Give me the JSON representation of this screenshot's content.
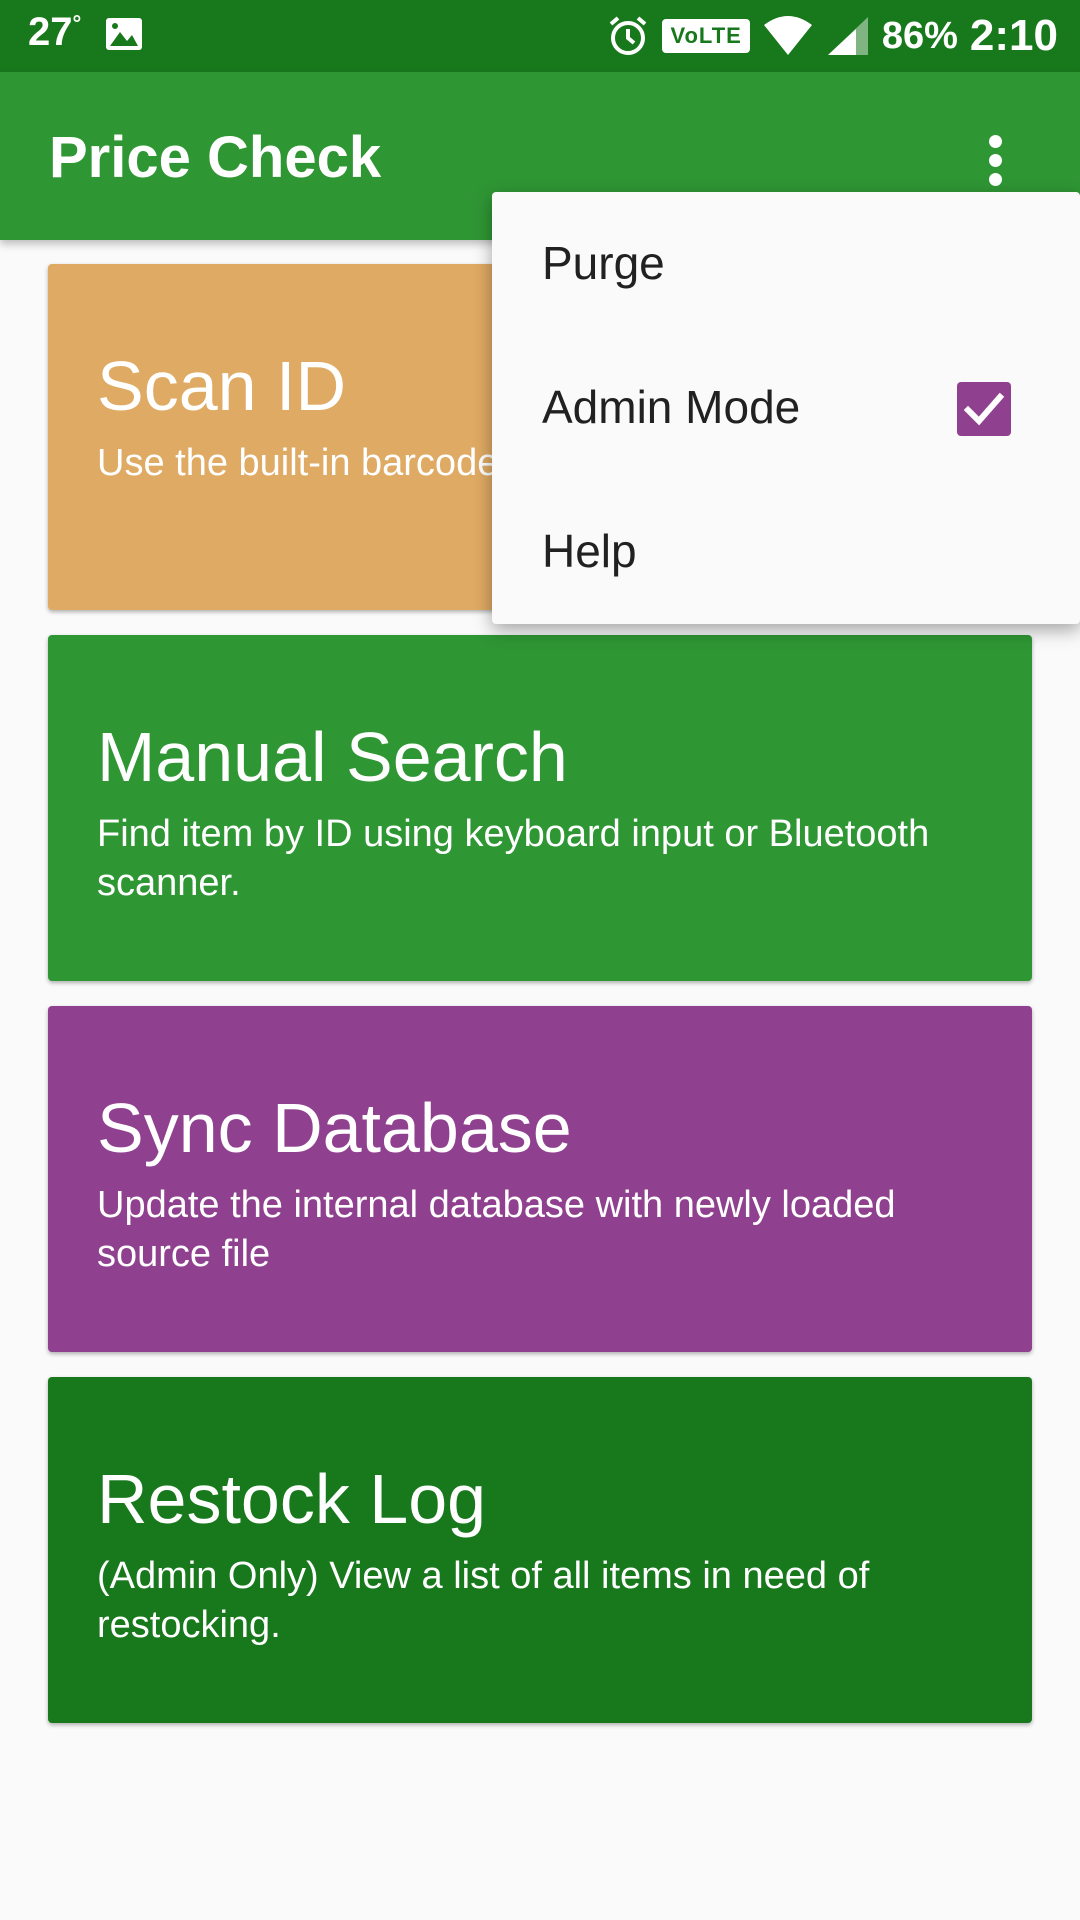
{
  "status_bar": {
    "temperature": "27",
    "degree_symbol": "°",
    "volte": "VoLTE",
    "battery": "86%",
    "time": "2:10"
  },
  "app_bar": {
    "title": "Price Check"
  },
  "menu": {
    "items": [
      {
        "label": "Purge"
      },
      {
        "label": "Admin Mode",
        "checked": true
      },
      {
        "label": "Help"
      }
    ]
  },
  "cards": [
    {
      "title": "Scan ID",
      "description": "Use the built-in barcode scanner to identify items",
      "color": "#dfaa63"
    },
    {
      "title": "Manual Search",
      "description": "Find item by ID using keyboard input or Bluetooth scanner.",
      "color": "#2f9634"
    },
    {
      "title": "Sync Database",
      "description": "Update the internal database with newly loaded source file",
      "color": "#8f418f"
    },
    {
      "title": "Restock Log",
      "description": "(Admin Only) View a list of all items in need of restocking.",
      "color": "#18781c"
    }
  ],
  "colors": {
    "status_bar": "#18781c",
    "app_bar": "#2f9634",
    "checkbox": "#8f418f",
    "background": "#fafafa"
  }
}
